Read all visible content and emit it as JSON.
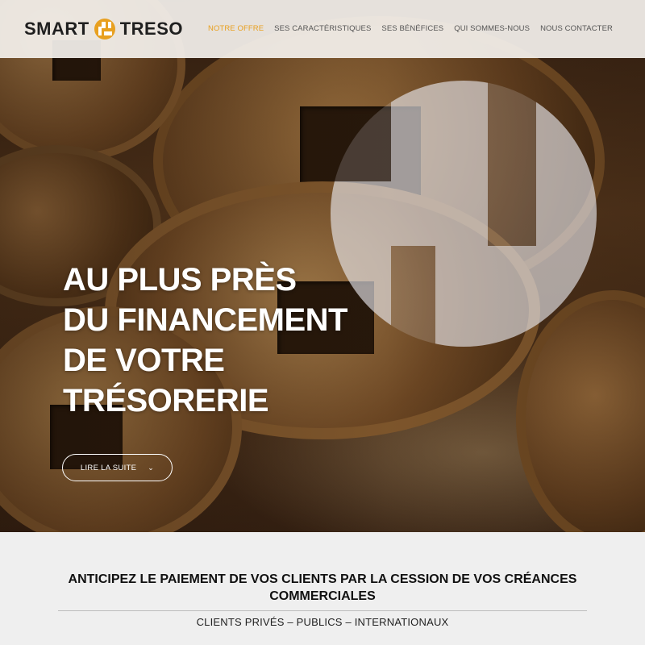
{
  "header": {
    "logo_left": "SMART",
    "logo_right": "TRESO",
    "brand_color": "#e8a020",
    "nav": [
      {
        "label": "NOTRE OFFRE",
        "active": true
      },
      {
        "label": "SES CARACTÉRISTIQUES",
        "active": false
      },
      {
        "label": "SES BÉNÉFICES",
        "active": false
      },
      {
        "label": "QUI SOMMES-NOUS",
        "active": false
      },
      {
        "label": "NOUS CONTACTER",
        "active": false
      }
    ]
  },
  "hero": {
    "headline_lines": [
      "AU PLUS PRÈS",
      "DU FINANCEMENT",
      "DE VOTRE",
      "TRÉSORERIE"
    ],
    "cta_label": "LIRE LA SUITE",
    "cta_icon": "chevron-down-icon",
    "background": "bronze-coins-photo"
  },
  "section": {
    "tagline_line1": "ANTICIPEZ LE PAIEMENT DE VOS CLIENTS PAR LA CESSION DE VOS CRÉANCES",
    "tagline_line2": "COMMERCIALES",
    "subline": "CLIENTS PRIVÉS – PUBLICS – INTERNATIONAUX"
  }
}
